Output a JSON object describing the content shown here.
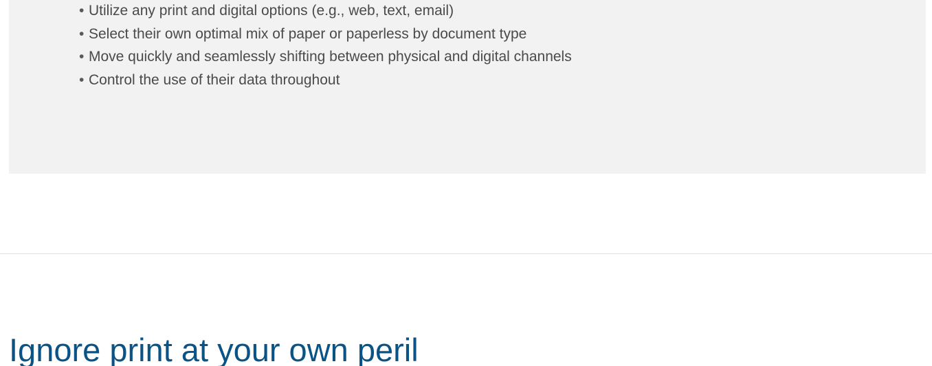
{
  "callout": {
    "bullet_symbol": "•",
    "items": [
      {
        "text": "Utilize any print and digital options (e.g., web, text, email)"
      },
      {
        "text": "Select their own optimal mix of paper or paperless by document type"
      },
      {
        "text": "Move quickly and seamlessly shifting between physical and digital channels"
      },
      {
        "text": "Control the use of their data throughout"
      }
    ]
  },
  "section": {
    "heading": "Ignore print at your own peril"
  },
  "colors": {
    "heading": "#0b5385",
    "body_text": "#4a4a4a",
    "callout_background": "#f2f2f2",
    "divider": "#e2e2e2"
  }
}
